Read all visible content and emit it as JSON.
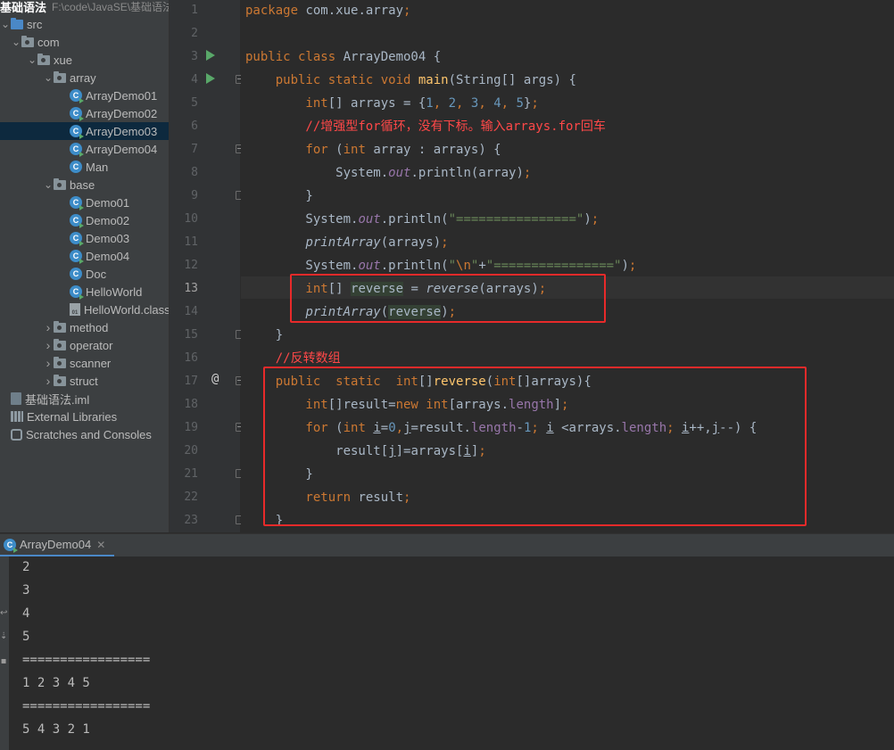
{
  "project": {
    "root": {
      "label": "基础语法",
      "path": "F:\\code\\JavaSE\\基础语法"
    },
    "items": [
      {
        "label": "src",
        "type": "src-folder",
        "depth": 0,
        "expanded": true
      },
      {
        "label": "com",
        "type": "package",
        "depth": 1,
        "expanded": true
      },
      {
        "label": "xue",
        "type": "package",
        "depth": 2,
        "expanded": true
      },
      {
        "label": "array",
        "type": "package",
        "depth": 3,
        "expanded": true
      },
      {
        "label": "ArrayDemo01",
        "type": "class-main",
        "depth": 4
      },
      {
        "label": "ArrayDemo02",
        "type": "class-main",
        "depth": 4
      },
      {
        "label": "ArrayDemo03",
        "type": "class-main",
        "depth": 4,
        "selected": true
      },
      {
        "label": "ArrayDemo04",
        "type": "class-main",
        "depth": 4
      },
      {
        "label": "Man",
        "type": "class",
        "depth": 4
      },
      {
        "label": "base",
        "type": "package",
        "depth": 3,
        "expanded": true
      },
      {
        "label": "Demo01",
        "type": "class-main",
        "depth": 4
      },
      {
        "label": "Demo02",
        "type": "class-main",
        "depth": 4
      },
      {
        "label": "Demo03",
        "type": "class-main",
        "depth": 4
      },
      {
        "label": "Demo04",
        "type": "class-main",
        "depth": 4
      },
      {
        "label": "Doc",
        "type": "class",
        "depth": 4
      },
      {
        "label": "HelloWorld",
        "type": "class-main",
        "depth": 4
      },
      {
        "label": "HelloWorld.class",
        "type": "class-file",
        "depth": 4
      },
      {
        "label": "method",
        "type": "package",
        "depth": 3,
        "expanded": false
      },
      {
        "label": "operator",
        "type": "package",
        "depth": 3,
        "expanded": false
      },
      {
        "label": "scanner",
        "type": "package",
        "depth": 3,
        "expanded": false
      },
      {
        "label": "struct",
        "type": "package",
        "depth": 3,
        "expanded": false
      },
      {
        "label": "基础语法.iml",
        "type": "iml",
        "depth": 0
      },
      {
        "label": "External Libraries",
        "type": "libraries",
        "depth": 0
      },
      {
        "label": "Scratches and Consoles",
        "type": "scratches",
        "depth": 0
      }
    ]
  },
  "editor": {
    "line_numbers": [
      "1",
      "2",
      "3",
      "4",
      "5",
      "6",
      "7",
      "8",
      "9",
      "10",
      "11",
      "12",
      "13",
      "14",
      "15",
      "16",
      "17",
      "18",
      "19",
      "20",
      "21",
      "22",
      "23"
    ],
    "current_line": "13",
    "lines": [
      [
        {
          "t": "package ",
          "c": "kw"
        },
        {
          "t": "com.xue.array",
          "c": ""
        },
        {
          "t": ";",
          "c": "kw"
        }
      ],
      [],
      [
        {
          "t": "public class ",
          "c": "kw"
        },
        {
          "t": "ArrayDemo04 {",
          "c": ""
        }
      ],
      [
        {
          "t": "    public static void ",
          "c": "kw"
        },
        {
          "t": "main",
          "c": "fn"
        },
        {
          "t": "(String[] args) {",
          "c": ""
        }
      ],
      [
        {
          "t": "        int",
          "c": "kw"
        },
        {
          "t": "[] arrays = {",
          "c": ""
        },
        {
          "t": "1",
          "c": "num"
        },
        {
          "t": ", ",
          "c": "kw"
        },
        {
          "t": "2",
          "c": "num"
        },
        {
          "t": ", ",
          "c": "kw"
        },
        {
          "t": "3",
          "c": "num"
        },
        {
          "t": ", ",
          "c": "kw"
        },
        {
          "t": "4",
          "c": "num"
        },
        {
          "t": ", ",
          "c": "kw"
        },
        {
          "t": "5",
          "c": "num"
        },
        {
          "t": "}",
          "c": ""
        },
        {
          "t": ";",
          "c": "kw"
        }
      ],
      [
        {
          "t": "        //增强型for循环，没有下标。输入arrays.for回车",
          "c": "cmt"
        }
      ],
      [
        {
          "t": "        for ",
          "c": "kw"
        },
        {
          "t": "(",
          "c": ""
        },
        {
          "t": "int ",
          "c": "kw"
        },
        {
          "t": "array : arrays) {",
          "c": ""
        }
      ],
      [
        {
          "t": "            System.",
          "c": ""
        },
        {
          "t": "out",
          "c": "field"
        },
        {
          "t": ".println(array)",
          "c": ""
        },
        {
          "t": ";",
          "c": "kw"
        }
      ],
      [
        {
          "t": "        }",
          "c": ""
        }
      ],
      [
        {
          "t": "        System.",
          "c": ""
        },
        {
          "t": "out",
          "c": "field"
        },
        {
          "t": ".println(",
          "c": ""
        },
        {
          "t": "\"================\"",
          "c": "str"
        },
        {
          "t": ")",
          "c": ""
        },
        {
          "t": ";",
          "c": "kw"
        }
      ],
      [
        {
          "t": "        ",
          "c": ""
        },
        {
          "t": "printArray",
          "c": "static-call"
        },
        {
          "t": "(arrays)",
          "c": ""
        },
        {
          "t": ";",
          "c": "kw"
        }
      ],
      [
        {
          "t": "        System.",
          "c": ""
        },
        {
          "t": "out",
          "c": "field"
        },
        {
          "t": ".println(",
          "c": ""
        },
        {
          "t": "\"",
          "c": "str"
        },
        {
          "t": "\\n",
          "c": "kw"
        },
        {
          "t": "\"",
          "c": "str"
        },
        {
          "t": "+",
          "c": ""
        },
        {
          "t": "\"================\"",
          "c": "str"
        },
        {
          "t": ")",
          "c": ""
        },
        {
          "t": ";",
          "c": "kw"
        }
      ],
      [
        {
          "t": "        int",
          "c": "kw"
        },
        {
          "t": "[] ",
          "c": ""
        },
        {
          "t": "reverse",
          "c": "bg-usage"
        },
        {
          "t": " = ",
          "c": ""
        },
        {
          "t": "reverse",
          "c": "static-call"
        },
        {
          "t": "(arrays)",
          "c": ""
        },
        {
          "t": ";",
          "c": "kw"
        }
      ],
      [
        {
          "t": "        ",
          "c": ""
        },
        {
          "t": "printArray",
          "c": "static-call"
        },
        {
          "t": "(",
          "c": ""
        },
        {
          "t": "reverse",
          "c": "bg-usage"
        },
        {
          "t": ")",
          "c": ""
        },
        {
          "t": ";",
          "c": "kw"
        }
      ],
      [
        {
          "t": "    }",
          "c": ""
        }
      ],
      [
        {
          "t": "    //反转数组",
          "c": "cmt"
        }
      ],
      [
        {
          "t": "    public  static  ",
          "c": "kw"
        },
        {
          "t": "int",
          "c": "kw"
        },
        {
          "t": "[]",
          "c": ""
        },
        {
          "t": "reverse",
          "c": "fn"
        },
        {
          "t": "(",
          "c": ""
        },
        {
          "t": "int",
          "c": "kw"
        },
        {
          "t": "[]arrays){",
          "c": ""
        }
      ],
      [
        {
          "t": "        int",
          "c": "kw"
        },
        {
          "t": "[]result=",
          "c": ""
        },
        {
          "t": "new int",
          "c": "kw"
        },
        {
          "t": "[arrays.",
          "c": ""
        },
        {
          "t": "length",
          "c": "fieldn"
        },
        {
          "t": "]",
          "c": ""
        },
        {
          "t": ";",
          "c": "kw"
        }
      ],
      [
        {
          "t": "        for ",
          "c": "kw"
        },
        {
          "t": "(",
          "c": ""
        },
        {
          "t": "int ",
          "c": "kw"
        },
        {
          "t": "i",
          "c": "ul"
        },
        {
          "t": "=",
          "c": ""
        },
        {
          "t": "0",
          "c": "num"
        },
        {
          "t": ",",
          "c": "kw"
        },
        {
          "t": "j",
          "c": "ul"
        },
        {
          "t": "=result.",
          "c": ""
        },
        {
          "t": "length",
          "c": "fieldn"
        },
        {
          "t": "-",
          "c": ""
        },
        {
          "t": "1",
          "c": "num"
        },
        {
          "t": "; ",
          "c": "kw"
        },
        {
          "t": "i",
          "c": "ul"
        },
        {
          "t": " <arrays.",
          "c": ""
        },
        {
          "t": "length",
          "c": "fieldn"
        },
        {
          "t": "; ",
          "c": "kw"
        },
        {
          "t": "i",
          "c": "ul"
        },
        {
          "t": "++,",
          "c": ""
        },
        {
          "t": "j",
          "c": "ul"
        },
        {
          "t": "--) {",
          "c": ""
        }
      ],
      [
        {
          "t": "            result[",
          "c": ""
        },
        {
          "t": "j",
          "c": "ul"
        },
        {
          "t": "]=arrays[",
          "c": ""
        },
        {
          "t": "i",
          "c": "ul"
        },
        {
          "t": "]",
          "c": ""
        },
        {
          "t": ";",
          "c": "kw"
        }
      ],
      [
        {
          "t": "        }",
          "c": ""
        }
      ],
      [
        {
          "t": "        return ",
          "c": "kw"
        },
        {
          "t": "result",
          "c": ""
        },
        {
          "t": ";",
          "c": "kw"
        }
      ],
      [
        {
          "t": "    }",
          "c": ""
        }
      ]
    ]
  },
  "run_panel": {
    "tab_label": "ArrayDemo04",
    "output": [
      "2",
      "3",
      "4",
      "5",
      "=================",
      "1 2 3 4 5",
      "=================",
      "5 4 3 2 1"
    ]
  },
  "icons": {
    "run_gutter": "run-triangle-icon",
    "override": "at-override-icon",
    "bulb": "lightbulb-icon",
    "fold": "fold-marker-icon",
    "close": "close-icon"
  },
  "colors": {
    "keyword": "#cc7832",
    "number": "#6897bb",
    "string": "#6a8759",
    "comment": "#ff4848",
    "method_decl": "#ffc66d",
    "field": "#9876aa",
    "annotation_box": "#e82a2a",
    "selection": "#0d293e"
  }
}
